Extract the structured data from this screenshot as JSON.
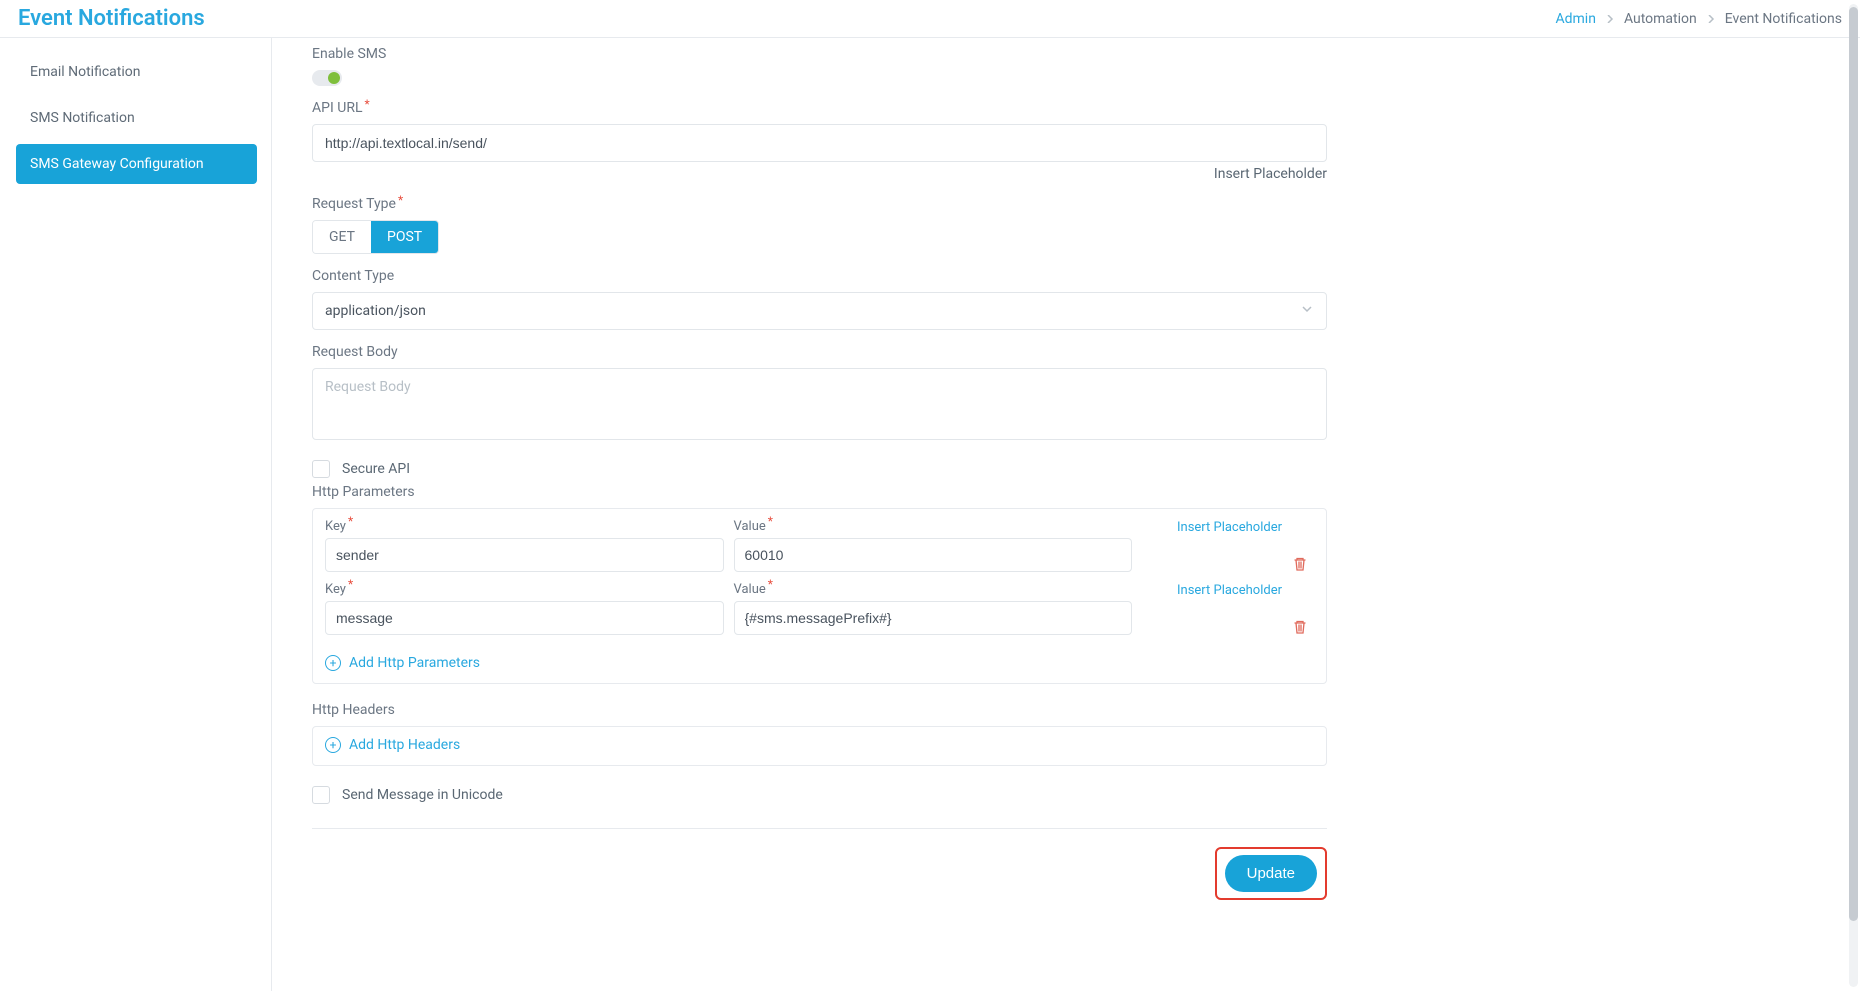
{
  "header": {
    "title": "Event Notifications",
    "breadcrumb": [
      {
        "label": "Admin",
        "link": true
      },
      {
        "label": "Automation",
        "link": false
      },
      {
        "label": "Event Notifications",
        "link": false
      }
    ]
  },
  "sidebar": {
    "items": [
      {
        "label": "Email Notification",
        "active": false
      },
      {
        "label": "SMS Notification",
        "active": false
      },
      {
        "label": "SMS Gateway Configuration",
        "active": true
      }
    ]
  },
  "form": {
    "enable_sms_label": "Enable SMS",
    "enable_sms_on": true,
    "api_url_label": "API URL",
    "api_url_value": "http://api.textlocal.in/send/",
    "insert_placeholder": "Insert Placeholder",
    "request_type_label": "Request Type",
    "request_types": {
      "get": "GET",
      "post": "POST",
      "active": "POST"
    },
    "content_type_label": "Content Type",
    "content_type_value": "application/json",
    "request_body_label": "Request Body",
    "request_body_placeholder": "Request Body",
    "request_body_value": "",
    "secure_api_label": "Secure API",
    "http_parameters_label": "Http Parameters",
    "key_label": "Key",
    "value_label": "Value",
    "params": [
      {
        "key": "sender",
        "value": "60010"
      },
      {
        "key": "message",
        "value": "{#sms.messagePrefix#}"
      }
    ],
    "add_http_params_label": "Add Http Parameters",
    "http_headers_label": "Http Headers",
    "add_http_headers_label": "Add Http Headers",
    "send_unicode_label": "Send Message in Unicode",
    "update_button": "Update"
  }
}
